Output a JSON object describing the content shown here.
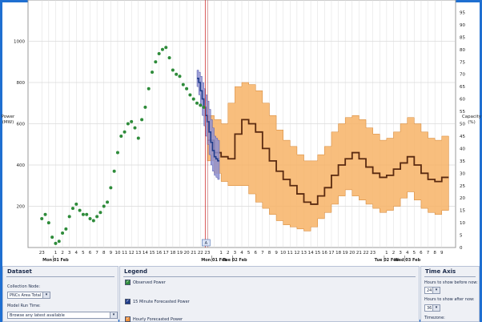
{
  "chart_data": {
    "type": "line",
    "ylabel": "Power\n(MW)",
    "y2label": "Capacity\n(%)",
    "ylim": [
      0,
      1200
    ],
    "y2lim": [
      0,
      100
    ],
    "yticks": [
      200,
      400,
      600,
      800,
      1000
    ],
    "y2ticks": [
      0,
      5,
      10,
      15,
      20,
      25,
      30,
      35,
      40,
      45,
      50,
      55,
      60,
      65,
      70,
      75,
      80,
      85,
      90,
      95
    ],
    "xlim": [
      -2,
      60
    ],
    "hour_ticks": [
      "23",
      "",
      "1",
      "2",
      "3",
      "4",
      "5",
      "6",
      "7",
      "8",
      "9",
      "10",
      "11",
      "12",
      "13",
      "14",
      "15",
      "16",
      "17",
      "18",
      "19",
      "20",
      "21",
      "22",
      "23",
      "",
      "1",
      "2",
      "3",
      "4",
      "5",
      "6",
      "7",
      "8",
      "9",
      "10",
      "11",
      "12",
      "13",
      "14",
      "15",
      "16",
      "17",
      "18",
      "19",
      "20",
      "21",
      "22",
      "23",
      "",
      "1",
      "2",
      "3",
      "4",
      "5",
      "6",
      "7",
      "8",
      "9"
    ],
    "hour_tick_start": 0,
    "day_labels": [
      {
        "x": 2,
        "text": "Mon 01 Feb"
      },
      {
        "x": 25,
        "text": "Mon 01 Feb"
      },
      {
        "x": 28,
        "text": "Tue 02 Feb"
      },
      {
        "x": 50,
        "text": "Tue 02 Feb"
      },
      {
        "x": 53,
        "text": "Wed 03 Feb"
      }
    ],
    "now_x": 23.7,
    "marker_label": "A",
    "series": [
      {
        "name": "Observed Power",
        "color": "#2e8b3a",
        "x": [
          0,
          0.5,
          1,
          1.5,
          2,
          2.5,
          3,
          3.5,
          4,
          4.5,
          5,
          5.5,
          6,
          6.5,
          7,
          7.5,
          8,
          8.5,
          9,
          9.5,
          10,
          10.5,
          11,
          11.5,
          12,
          12.5,
          13,
          13.5,
          14,
          14.5,
          15,
          15.5,
          16,
          16.5,
          17,
          17.5,
          18,
          18.5,
          19,
          19.5,
          20,
          20.5,
          21,
          21.5,
          22,
          22.5,
          23,
          23.5
        ],
        "values": [
          140,
          160,
          120,
          50,
          20,
          30,
          70,
          90,
          150,
          190,
          210,
          180,
          160,
          160,
          140,
          130,
          150,
          170,
          200,
          220,
          290,
          370,
          460,
          540,
          560,
          600,
          610,
          580,
          530,
          620,
          680,
          770,
          850,
          900,
          940,
          960,
          970,
          920,
          860,
          840,
          830,
          790,
          770,
          740,
          720,
          700,
          690,
          680
        ]
      },
      {
        "name": "15 Minute Forecasted Power",
        "color": "#1f3c8a",
        "fill": "#8d8fd0",
        "x": [
          22.5,
          22.75,
          23,
          23.25,
          23.5,
          23.75,
          24,
          24.25,
          24.5,
          24.75,
          25,
          25.25,
          25.5
        ],
        "values": [
          820,
          800,
          760,
          720,
          680,
          640,
          610,
          560,
          510,
          470,
          440,
          430,
          420
        ],
        "lower": [
          780,
          740,
          690,
          640,
          590,
          540,
          500,
          450,
          400,
          370,
          350,
          340,
          330
        ],
        "upper": [
          860,
          850,
          830,
          800,
          770,
          740,
          710,
          670,
          620,
          580,
          540,
          530,
          520
        ]
      },
      {
        "name": "Hourly Forecasted Power",
        "color": "#5a2a10",
        "fill": "#f7b366",
        "x": [
          24,
          25,
          26,
          27,
          28,
          29,
          30,
          31,
          32,
          33,
          34,
          35,
          36,
          37,
          38,
          39,
          40,
          41,
          42,
          43,
          44,
          45,
          46,
          47,
          48,
          49,
          50,
          51,
          52,
          53,
          54,
          55,
          56,
          57,
          58
        ],
        "values": [
          520,
          460,
          440,
          430,
          550,
          620,
          600,
          560,
          480,
          420,
          370,
          330,
          300,
          260,
          220,
          210,
          250,
          290,
          350,
          400,
          430,
          460,
          430,
          390,
          360,
          340,
          350,
          380,
          410,
          440,
          400,
          360,
          330,
          320,
          340
        ],
        "lower": [
          420,
          360,
          320,
          300,
          300,
          300,
          260,
          220,
          190,
          160,
          130,
          110,
          100,
          90,
          80,
          100,
          140,
          170,
          210,
          250,
          280,
          250,
          230,
          210,
          190,
          170,
          180,
          200,
          240,
          270,
          230,
          190,
          170,
          160,
          180
        ],
        "upper": [
          640,
          620,
          600,
          700,
          780,
          800,
          790,
          760,
          700,
          640,
          570,
          520,
          490,
          450,
          420,
          420,
          450,
          490,
          560,
          600,
          630,
          640,
          620,
          580,
          550,
          520,
          530,
          560,
          600,
          630,
          600,
          560,
          530,
          520,
          540
        ]
      }
    ]
  },
  "panels": {
    "dataset": {
      "title": "Dataset",
      "collection_node_label": "Collection Node:",
      "collection_node_value": "PNCs Area Total",
      "model_run_label": "Model Run Time:",
      "model_run_value": "Browse any latest available"
    },
    "legend": {
      "title": "Legend",
      "items": [
        {
          "label": "Observed Power",
          "color": "#2e8b3a"
        },
        {
          "label": "15 Minute Forecasted Power",
          "color": "#1f3c8a"
        },
        {
          "label": "Hourly Forecasted Power",
          "color": "#f0903a"
        }
      ]
    },
    "time_axis": {
      "title": "Time Axis",
      "before_label": "Hours to show before now:",
      "before_value": "24",
      "after_label": "Hours to show after now:",
      "after_value": "36",
      "timezone_label": "Timezone:"
    }
  }
}
